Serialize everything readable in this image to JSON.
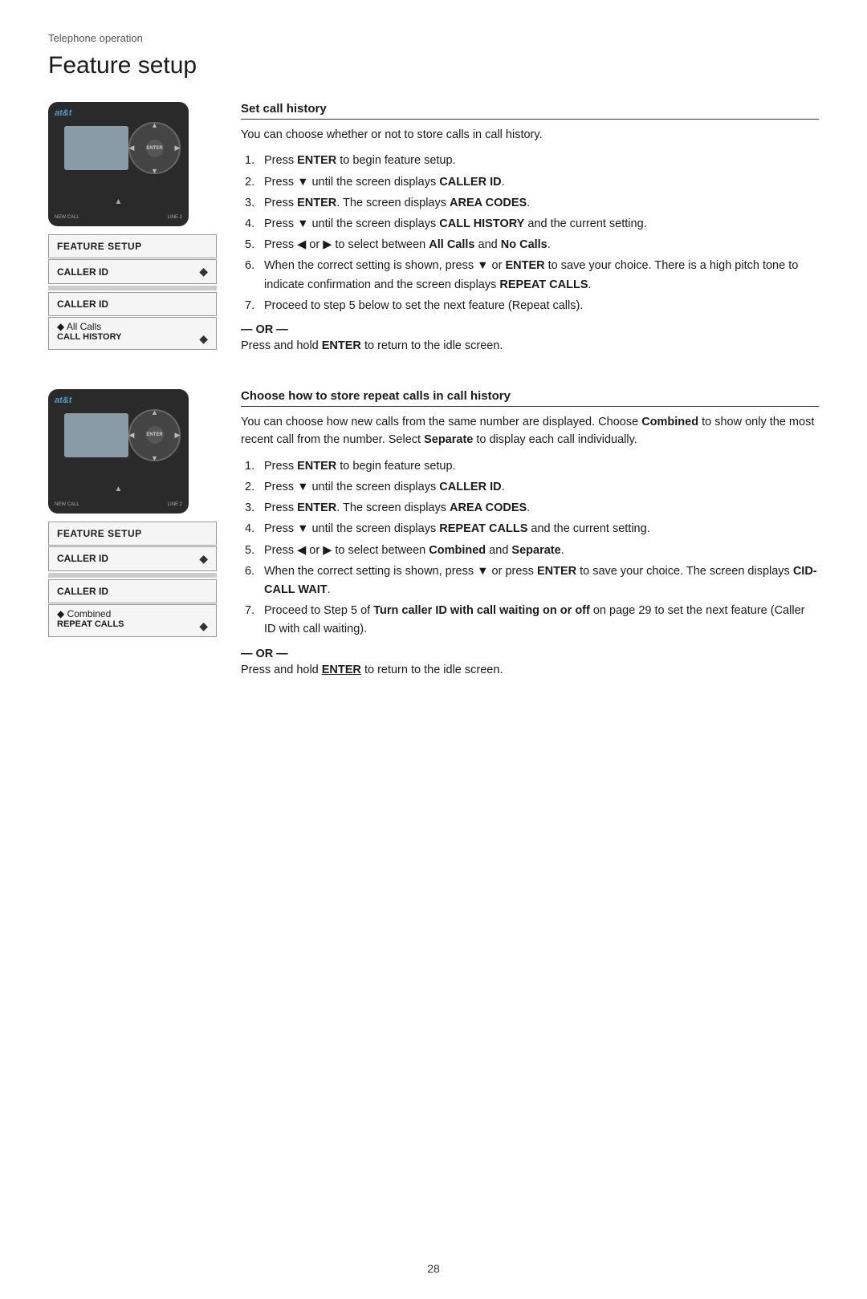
{
  "breadcrumb": "Telephone operation",
  "page_title": "Feature setup",
  "section1": {
    "title": "Set call history",
    "intro": "You can choose whether or not to store calls in call history.",
    "steps": [
      {
        "num": "1.",
        "text_plain": "Press ",
        "bold1": "ENTER",
        "text2": " to begin feature setup."
      },
      {
        "num": "2.",
        "text_plain": "Press ▼ until the screen displays ",
        "bold1": "CALLER ID",
        "text2": "."
      },
      {
        "num": "3.",
        "text_plain": "Press ",
        "bold1": "ENTER",
        "text2": ". The screen displays ",
        "bold2": "AREA CODES",
        "text3": "."
      },
      {
        "num": "4.",
        "text_plain": "Press ▼ until the screen displays ",
        "bold1": "CALL HISTORY",
        "text2": " and the current setting."
      },
      {
        "num": "5.",
        "text_plain": "Press ◀ or ▶ to select between ",
        "bold1": "All Calls",
        "text2": " and ",
        "bold2": "No Calls",
        "text3": "."
      },
      {
        "num": "6.",
        "text_plain": "When the correct setting is shown, press ▼ or ",
        "bold1": "ENTER",
        "text2": " to save your choice. There is a high pitch tone to indicate confirmation and the screen displays ",
        "bold2": "REPEAT CALLS",
        "text3": "."
      },
      {
        "num": "7.",
        "text_plain": "Proceed to step 5 below to set the next feature (Repeat calls)."
      }
    ],
    "or_label": "— OR —",
    "or_text": "Press and hold ",
    "or_bold": "ENTER",
    "or_text2": " to return to the idle screen."
  },
  "device1": {
    "brand": "at&t",
    "lcd_rows": [
      {
        "text": "FEATURE SETUP",
        "has_arrow": false
      },
      {
        "text": "CALLER ID",
        "has_arrow": true
      },
      {
        "text": "CALLER ID",
        "has_arrow": false
      },
      {
        "text": "◆ All Calls",
        "sub": "CALL HISTORY",
        "has_arrow": true
      }
    ]
  },
  "section2": {
    "title": "Choose how to store repeat calls in call history",
    "intro": "You can choose how new calls from the same number are displayed. Choose ",
    "bold1": "Combined",
    "intro2": " to show only the most recent call from the number. Select ",
    "bold2": "Separate",
    "intro3": " to display each call individually.",
    "steps": [
      {
        "num": "1.",
        "text_plain": "Press ",
        "bold1": "ENTER",
        "text2": " to begin feature setup."
      },
      {
        "num": "2.",
        "text_plain": "Press ▼ until the screen displays ",
        "bold1": "CALLER ID",
        "text2": "."
      },
      {
        "num": "3.",
        "text_plain": "Press ",
        "bold1": "ENTER",
        "text2": ". The screen displays ",
        "bold2": "AREA CODES",
        "text3": "."
      },
      {
        "num": "4.",
        "text_plain": "Press ▼ until the screen displays ",
        "bold1": "REPEAT CALLS",
        "text2": " and the current setting."
      },
      {
        "num": "5.",
        "text_plain": "Press ◀ or ▶ to select between ",
        "bold1": "Combined",
        "text2": " and ",
        "bold2": "Separate",
        "text3": "."
      },
      {
        "num": "6.",
        "text_plain": "When the correct setting is shown, press ▼ or press ",
        "bold1": "ENTER",
        "text2": " to save your choice. The screen displays ",
        "bold2": "CID-CALL WAIT",
        "text3": "."
      },
      {
        "num": "7.",
        "text_plain": "Proceed to Step 5 of ",
        "bold1": "Turn caller ID with call waiting on or off",
        "text2": " on page 29 to set the next feature (Caller ID with call waiting)."
      }
    ],
    "or_label": "— OR —",
    "or_text": "Press and hold ",
    "or_bold": "ENTER",
    "or_text2": " to return to the idle screen."
  },
  "device2": {
    "brand": "at&t",
    "lcd_rows": [
      {
        "text": "FEATURE SETUP",
        "has_arrow": false
      },
      {
        "text": "CALLER ID",
        "has_arrow": true
      },
      {
        "text": "CALLER ID",
        "has_arrow": false
      },
      {
        "text": "◆ Combined",
        "sub": "REPEAT CALLS",
        "has_arrow": true
      }
    ]
  },
  "page_number": "28"
}
